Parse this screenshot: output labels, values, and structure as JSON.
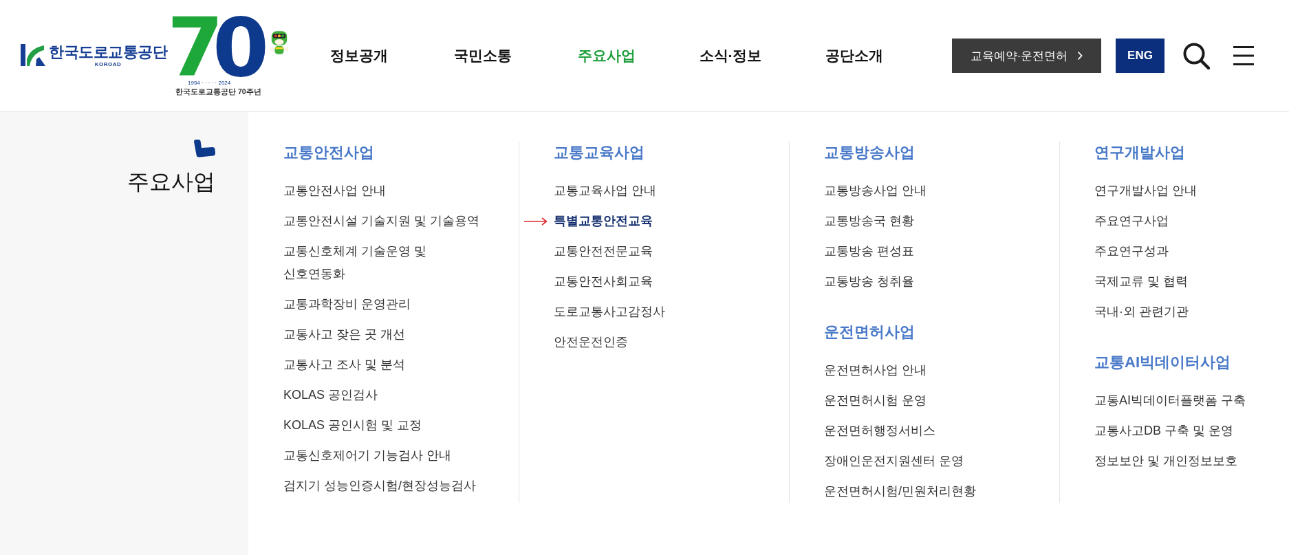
{
  "header": {
    "logo": {
      "name": "한국도로교통공단",
      "roman": "KOROAD"
    },
    "emblem": {
      "number": "70",
      "years": "1954 · · · · · 2024",
      "caption": "한국도로교통공단 70주년"
    },
    "nav": [
      {
        "label": "정보공개",
        "selected": false
      },
      {
        "label": "국민소통",
        "selected": false
      },
      {
        "label": "주요사업",
        "selected": true
      },
      {
        "label": "소식·정보",
        "selected": false
      },
      {
        "label": "공단소개",
        "selected": false
      }
    ],
    "buttons": [
      {
        "kind": "shortcut",
        "label": "교육예약·운전면허"
      },
      {
        "kind": "language",
        "label": "ENG"
      }
    ]
  },
  "sidebar": {
    "title": "주요사업"
  },
  "menu": {
    "columns": [
      {
        "sections": [
          {
            "title": "교통안전사업",
            "items": [
              {
                "label": "교통안전사업 안내",
                "selected": false
              },
              {
                "label": "교통안전시설 기술지원 및 기술용역",
                "selected": false
              },
              {
                "label": "교통신호체계 기술운영 및\n신호연동화",
                "selected": false
              },
              {
                "label": "교통과학장비 운영관리",
                "selected": false
              },
              {
                "label": "교통사고 잦은 곳 개선",
                "selected": false
              },
              {
                "label": "교통사고 조사 및 분석",
                "selected": false
              },
              {
                "label": "KOLAS 공인검사",
                "selected": false
              },
              {
                "label": "KOLAS 공인시험 및 교정",
                "selected": false
              },
              {
                "label": "교통신호제어기 기능검사 안내",
                "selected": false
              },
              {
                "label": "검지기 성능인증시험/현장성능검사",
                "selected": false
              }
            ]
          }
        ]
      },
      {
        "sections": [
          {
            "title": "교통교육사업",
            "items": [
              {
                "label": "교통교육사업 안내",
                "selected": false
              },
              {
                "label": "특별교통안전교육",
                "selected": true
              },
              {
                "label": "교통안전전문교육",
                "selected": false
              },
              {
                "label": "교통안전사회교육",
                "selected": false
              },
              {
                "label": "도로교통사고감정사",
                "selected": false
              },
              {
                "label": "안전운전인증",
                "selected": false
              }
            ]
          }
        ]
      },
      {
        "sections": [
          {
            "title": "교통방송사업",
            "items": [
              {
                "label": "교통방송사업 안내",
                "selected": false
              },
              {
                "label": "교통방송국 현황",
                "selected": false
              },
              {
                "label": "교통방송 편성표",
                "selected": false
              },
              {
                "label": "교통방송 청취율",
                "selected": false
              }
            ]
          },
          {
            "title": "운전면허사업",
            "items": [
              {
                "label": "운전면허사업 안내",
                "selected": false
              },
              {
                "label": "운전면허시험 운영",
                "selected": false
              },
              {
                "label": "운전면허행정서비스",
                "selected": false
              },
              {
                "label": "장애인운전지원센터 운영",
                "selected": false
              },
              {
                "label": "운전면허시험/민원처리현황",
                "selected": false
              }
            ]
          }
        ]
      },
      {
        "sections": [
          {
            "title": "연구개발사업",
            "items": [
              {
                "label": "연구개발사업 안내",
                "selected": false
              },
              {
                "label": "주요연구사업",
                "selected": false
              },
              {
                "label": "주요연구성과",
                "selected": false
              },
              {
                "label": "국제교류 및 협력",
                "selected": false
              },
              {
                "label": "국내·외 관련기관",
                "selected": false
              }
            ]
          },
          {
            "title": "교통AI빅데이터사업",
            "items": [
              {
                "label": "교통AI빅데이터플랫폼 구축",
                "selected": false
              },
              {
                "label": "교통사고DB 구축 및 운영",
                "selected": false
              },
              {
                "label": "정보보안 및 개인정보보호",
                "selected": false
              }
            ]
          }
        ]
      }
    ]
  }
}
